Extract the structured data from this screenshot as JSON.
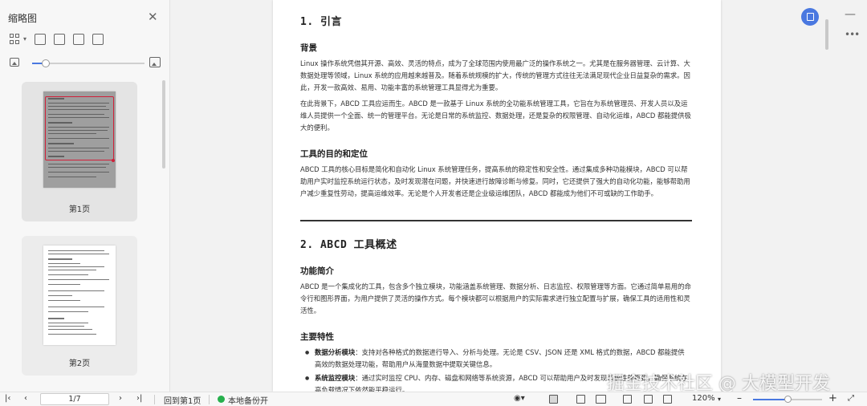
{
  "sidebar": {
    "title": "缩略图",
    "close_icon": "close-icon",
    "tools": [
      "grid-view-icon",
      "add-page-icon",
      "page-settings-icon",
      "copy-page-icon",
      "duplicate-page-icon"
    ],
    "thumb_zoom": 0.12,
    "thumbnails": [
      {
        "label": "第1页",
        "active": true
      },
      {
        "label": "第2页",
        "active": false
      }
    ]
  },
  "document": {
    "section1_title": "1. 引言",
    "background_heading": "背景",
    "background_p1": "Linux 操作系统凭借其开源、高效、灵活的特点，成为了全球范围内使用最广泛的操作系统之一。尤其是在服务器管理、云计算、大数据处理等领域，Linux 系统的应用越来越普及。随着系统规模的扩大，传统的管理方式往往无法满足现代企业日益复杂的需求。因此，开发一款高效、易用、功能丰富的系统管理工具显得尤为重要。",
    "background_p2": "在此背景下，ABCD 工具应运而生。ABCD 是一款基于 Linux 系统的全功能系统管理工具，它旨在为系统管理员、开发人员以及运维人员提供一个全面、统一的管理平台。无论是日常的系统监控、数据处理，还是复杂的权限管理、自动化运维，ABCD 都能提供极大的便利。",
    "purpose_heading": "工具的目的和定位",
    "purpose_p": "ABCD 工具的核心目标是简化和自动化 Linux 系统管理任务，提高系统的稳定性和安全性。通过集成多种功能模块，ABCD 可以帮助用户实时监控系统运行状态，及时发现潜在问题，并快速进行故障诊断与修复。同时，它还提供了强大的自动化功能，能够帮助用户减少重复性劳动，提高运维效率。无论是个人开发者还是企业级运维团队，ABCD 都能成为他们不可或缺的工作助手。",
    "section2_title": "2. ABCD 工具概述",
    "intro_heading": "功能简介",
    "intro_p": "ABCD 是一个集成化的工具，包含多个独立模块，功能涵盖系统管理、数据分析、日志监控、权限管理等方面。它通过简单易用的命令行和图形界面，为用户提供了灵活的操作方式。每个模块都可以根据用户的实际需求进行独立配置与扩展，确保工具的适用性和灵活性。",
    "features_heading": "主要特性",
    "features": [
      {
        "name": "数据分析模块",
        "text": "：支持对各种格式的数据进行导入、分析与处理。无论是 CSV、JSON 还是 XML 格式的数据，ABCD 都能提供高效的数据处理功能，帮助用户从海量数据中提取关键信息。"
      },
      {
        "name": "系统监控模块",
        "text": "：通过实时监控 CPU、内存、磁盘和网络等系统资源，ABCD 可以帮助用户及时发现系统性能瓶颈，确保系统在高负载情况下依然能平稳运行。"
      }
    ]
  },
  "watermark": "掘金技术社区 @ 大模型开发",
  "statusbar": {
    "first_icon": "first-page-icon",
    "prev_icon": "prev-page-icon",
    "page_indicator": "1/7",
    "next_icon": "next-page-icon",
    "last_icon": "last-page-icon",
    "back_to_first": "回到第1页",
    "backup": "本地备份开",
    "zoom_level": "120%",
    "zoom_minus": "–",
    "zoom_plus": "+",
    "zoom_fraction": 0.5,
    "fit_icon": "fit-screen-icon"
  },
  "colors": {
    "accent": "#4a78e0",
    "green": "#27b04d",
    "red": "#d0213a"
  }
}
